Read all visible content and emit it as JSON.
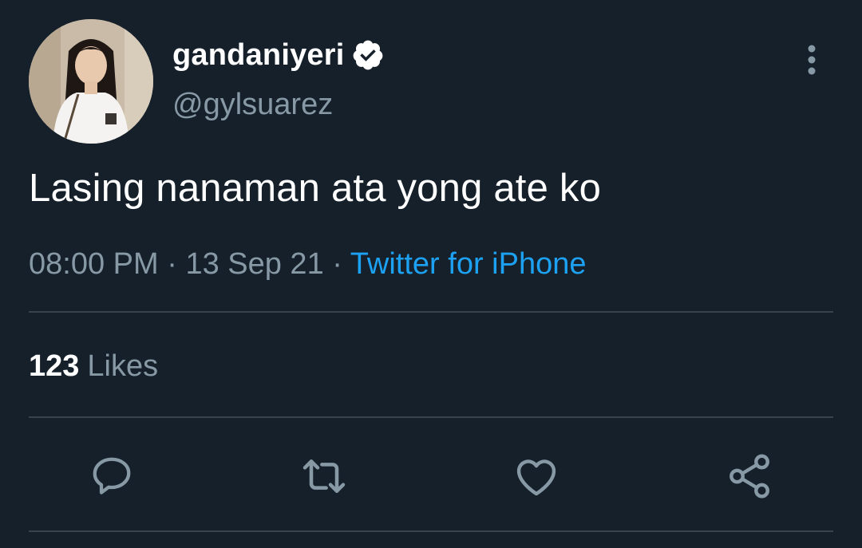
{
  "user": {
    "display_name": "gandaniyeri",
    "handle": "@gylsuarez",
    "verified": true
  },
  "tweet": {
    "text": "Lasing nanaman ata yong ate ko",
    "time": "08:00 PM",
    "separator1": " · ",
    "date": "13 Sep 21",
    "separator2": " · ",
    "source": "Twitter for iPhone"
  },
  "stats": {
    "likes_count": "123",
    "likes_label": "Likes"
  },
  "actions": [
    "reply-icon",
    "retweet-icon",
    "like-icon",
    "share-icon"
  ],
  "colors": {
    "background": "#15202b",
    "primary_text": "#ffffff",
    "secondary_text": "#8899a6",
    "link": "#1da1f2",
    "divider": "#38444d"
  }
}
